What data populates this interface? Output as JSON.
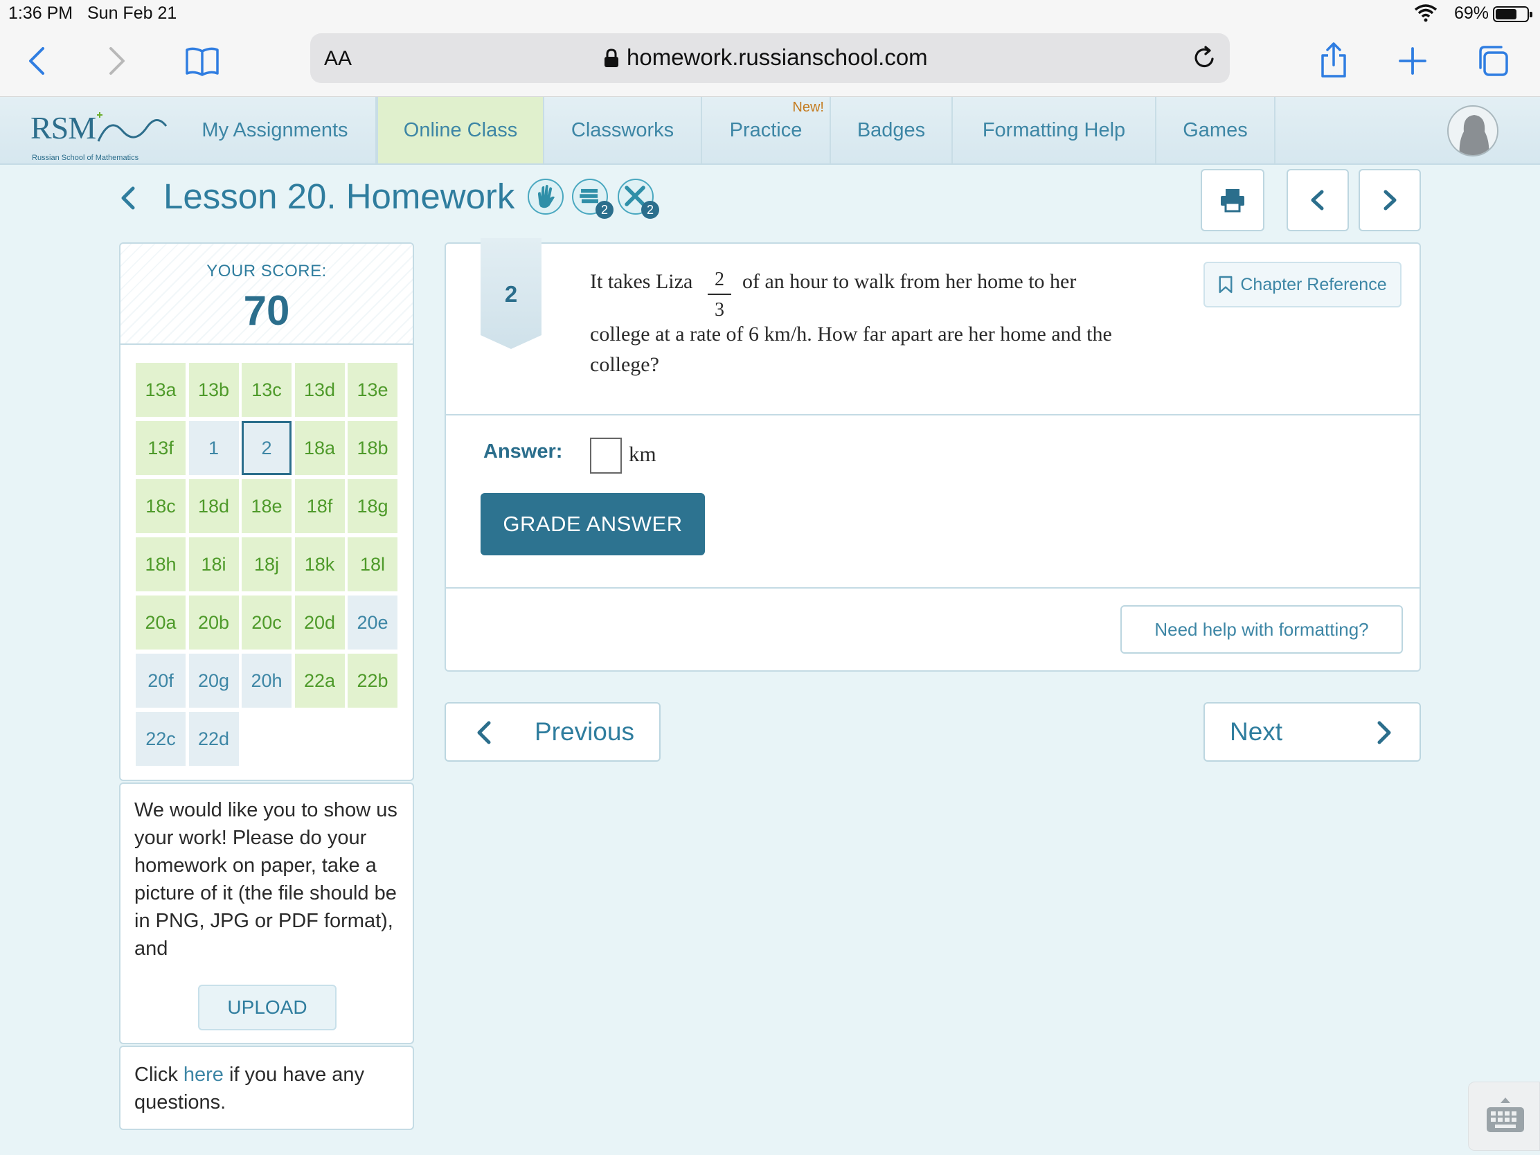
{
  "status": {
    "time": "1:36 PM",
    "date": "Sun Feb 21",
    "battery": "69%",
    "battery_level": 0.69
  },
  "browser": {
    "text_size": "AA",
    "url": "homework.russianschool.com"
  },
  "logo": {
    "text": "RSM",
    "subtitle": "Russian School of Mathematics"
  },
  "nav": {
    "items": [
      {
        "label": "My Assignments"
      },
      {
        "label": "Online Class"
      },
      {
        "label": "Classworks"
      },
      {
        "label": "Practice",
        "tag": "New!"
      },
      {
        "label": "Badges"
      },
      {
        "label": "Formatting Help"
      },
      {
        "label": "Games"
      }
    ]
  },
  "lesson": {
    "title": "Lesson 20. Homework",
    "badge_count_1": "2",
    "badge_count_2": "2"
  },
  "score": {
    "label": "YOUR SCORE:",
    "value": "70",
    "problems": [
      {
        "id": "13a",
        "state": "green"
      },
      {
        "id": "13b",
        "state": "green"
      },
      {
        "id": "13c",
        "state": "green"
      },
      {
        "id": "13d",
        "state": "green"
      },
      {
        "id": "13e",
        "state": "green"
      },
      {
        "id": "13f",
        "state": "green"
      },
      {
        "id": "1",
        "state": "blue"
      },
      {
        "id": "2",
        "state": "current"
      },
      {
        "id": "18a",
        "state": "green"
      },
      {
        "id": "18b",
        "state": "green"
      },
      {
        "id": "18c",
        "state": "green"
      },
      {
        "id": "18d",
        "state": "green"
      },
      {
        "id": "18e",
        "state": "green"
      },
      {
        "id": "18f",
        "state": "green"
      },
      {
        "id": "18g",
        "state": "green"
      },
      {
        "id": "18h",
        "state": "green"
      },
      {
        "id": "18i",
        "state": "green"
      },
      {
        "id": "18j",
        "state": "green"
      },
      {
        "id": "18k",
        "state": "green"
      },
      {
        "id": "18l",
        "state": "green"
      },
      {
        "id": "20a",
        "state": "green"
      },
      {
        "id": "20b",
        "state": "green"
      },
      {
        "id": "20c",
        "state": "green"
      },
      {
        "id": "20d",
        "state": "green"
      },
      {
        "id": "20e",
        "state": "blue"
      },
      {
        "id": "20f",
        "state": "blue"
      },
      {
        "id": "20g",
        "state": "blue"
      },
      {
        "id": "20h",
        "state": "blue"
      },
      {
        "id": "22a",
        "state": "green"
      },
      {
        "id": "22b",
        "state": "green"
      },
      {
        "id": "22c",
        "state": "blue"
      },
      {
        "id": "22d",
        "state": "blue"
      }
    ]
  },
  "work": {
    "text": "We would like you to show us your work! Please do your homework on paper, take a picture of it (the file should be in PNG, JPG or PDF format), and",
    "upload_label": "UPLOAD"
  },
  "help": {
    "prefix": "Click ",
    "link": "here",
    "suffix": " if you have any questions."
  },
  "problem": {
    "number": "2",
    "text_before": "It takes Liza",
    "fraction_num": "2",
    "fraction_den": "3",
    "text_after": "of an hour to walk from her home to her",
    "line2": "college at a rate of 6 km/h. How far apart are her home and the",
    "line3": "college?",
    "chapter_ref": "Chapter Reference",
    "answer_label": "Answer:",
    "answer_value": "",
    "unit": "km",
    "grade_label": "GRADE ANSWER",
    "format_help": "Need help with formatting?"
  },
  "pager": {
    "previous": "Previous",
    "next": "Next"
  },
  "colors": {
    "accent": "#2d7390",
    "link": "#3d86a5",
    "done": "#e2f2cf",
    "pending": "#e4eef3"
  }
}
